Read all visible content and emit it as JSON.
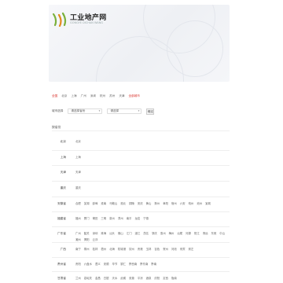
{
  "brand": {
    "name": "工业地产网",
    "tagline": "GONGYE DICHAN WANG"
  },
  "colors": {
    "accent": "#d9302a",
    "logo_green": "#7bb13c",
    "logo_orange": "#e38a1e"
  },
  "city_tabs": [
    {
      "label": "全国",
      "active": true
    },
    {
      "label": "北京"
    },
    {
      "label": "上海"
    },
    {
      "label": "广州"
    },
    {
      "label": "深圳"
    },
    {
      "label": "杭州"
    },
    {
      "label": "苏州"
    },
    {
      "label": "天津"
    },
    {
      "label": "全部城市",
      "all": true
    }
  ],
  "search": {
    "label": "城市选择",
    "province_value": "请选择省份",
    "city_value": "请选择",
    "submit_label": "确定"
  },
  "section_title": "按省份",
  "rows": [
    {
      "label": "北京",
      "items": [
        "北京"
      ]
    },
    {
      "label": "上海",
      "items": [
        "上海"
      ]
    },
    {
      "label": "天津",
      "items": [
        "天津"
      ]
    },
    {
      "label": "重庆",
      "items": [
        "重庆"
      ]
    },
    {
      "label": "安徽省",
      "items": [
        "合肥",
        "芜湖",
        "蚌埠",
        "淮南",
        "马鞍山",
        "淮北",
        "铜陵",
        "安庆",
        "黄山",
        "滁州",
        "阜阳",
        "宿州",
        "六安",
        "亳州",
        "池州",
        "宣城"
      ]
    },
    {
      "label": "福建省",
      "items": [
        "福州",
        "厦门",
        "莆田",
        "三明",
        "泉州",
        "漳州",
        "南平",
        "龙岩",
        "宁德"
      ]
    },
    {
      "label": "广东省",
      "items": [
        "广州",
        "韶关",
        "深圳",
        "珠海",
        "汕头",
        "佛山",
        "江门",
        "湛江",
        "茂名",
        "肇庆",
        "惠州",
        "梅州",
        "汕尾",
        "河源",
        "阳江",
        "清远",
        "东莞",
        "中山",
        "潮州",
        "揭阳",
        "云浮"
      ]
    },
    {
      "label": "广西",
      "items": [
        "南宁",
        "柳州",
        "桂林",
        "梧州",
        "北海",
        "防城港",
        "钦州",
        "贵港",
        "玉林",
        "百色",
        "贺州",
        "河池",
        "来宾",
        "崇左"
      ]
    },
    {
      "label": "贵州省",
      "items": [
        "贵阳",
        "六盘水",
        "遵义",
        "安顺",
        "毕节",
        "铜仁",
        "黔西南",
        "黔东南",
        "黔南"
      ]
    },
    {
      "label": "甘肃省",
      "items": [
        "兰州",
        "嘉峪关",
        "金昌",
        "白银",
        "天水",
        "武威",
        "张掖",
        "平凉",
        "酒泉",
        "庆阳",
        "定西",
        "陇南"
      ]
    }
  ]
}
